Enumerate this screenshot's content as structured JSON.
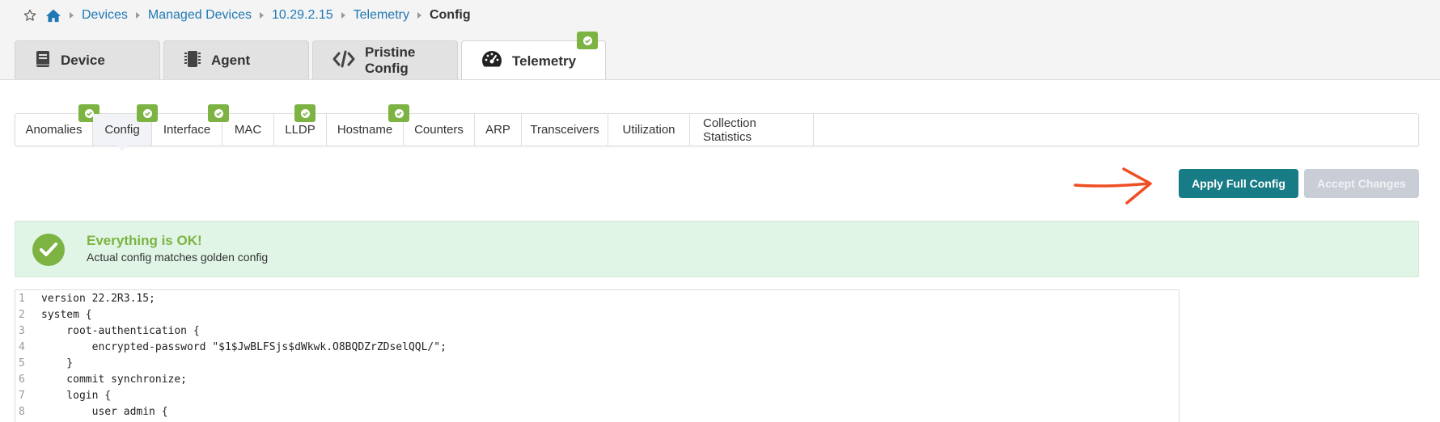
{
  "breadcrumb": {
    "items": [
      "Devices",
      "Managed Devices",
      "10.29.2.15",
      "Telemetry"
    ],
    "current": "Config"
  },
  "top_tabs": [
    {
      "label": "Device",
      "icon": "book-icon"
    },
    {
      "label": "Agent",
      "icon": "chip-icon"
    },
    {
      "label": "Pristine Config",
      "icon": "code-icon"
    },
    {
      "label": "Telemetry",
      "icon": "gauge-icon",
      "active": true,
      "status": "ok"
    }
  ],
  "sub_tabs": [
    {
      "label": "Anomalies",
      "status": "ok"
    },
    {
      "label": "Config",
      "status": "ok",
      "active": true
    },
    {
      "label": "Interface",
      "status": "ok"
    },
    {
      "label": "MAC"
    },
    {
      "label": "LLDP",
      "status": "ok"
    },
    {
      "label": "Hostname",
      "status": "ok"
    },
    {
      "label": "Counters"
    },
    {
      "label": "ARP"
    },
    {
      "label": "Transceivers"
    },
    {
      "label": "Utilization"
    },
    {
      "label": "Collection Statistics"
    }
  ],
  "actions": {
    "apply_label": "Apply Full Config",
    "accept_label": "Accept Changes"
  },
  "alert": {
    "title": "Everything is OK!",
    "message": "Actual config matches golden config"
  },
  "code_lines": [
    {
      "n": "1",
      "text": "version 22.2R3.15;"
    },
    {
      "n": "2",
      "text": "system {"
    },
    {
      "n": "3",
      "text": "    root-authentication {"
    },
    {
      "n": "4",
      "text": "        encrypted-password \"$1$JwBLFSjs$dWkwk.O8BQDZrZDselQQL/\";"
    },
    {
      "n": "5",
      "text": "    }"
    },
    {
      "n": "6",
      "text": "    commit synchronize;"
    },
    {
      "n": "7",
      "text": "    login {"
    },
    {
      "n": "8",
      "text": "        user admin {"
    }
  ],
  "colors": {
    "accent": "#187c86",
    "link": "#1f78b4",
    "ok": "#7cb342",
    "disabled": "#c9cdd6",
    "annotation_arrow": "#f04e23"
  }
}
